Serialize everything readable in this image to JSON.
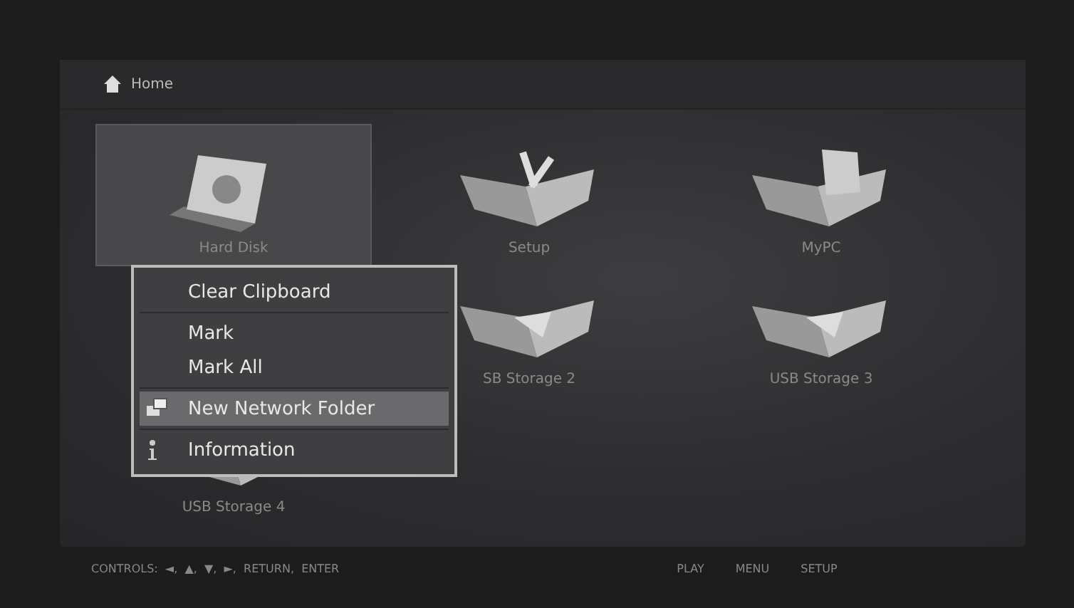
{
  "header": {
    "title": "Home"
  },
  "tiles": [
    {
      "label": "Hard Disk",
      "kind": "disk",
      "selected": true
    },
    {
      "label": "Setup",
      "kind": "setup",
      "selected": false
    },
    {
      "label": "MyPC",
      "kind": "pc",
      "selected": false
    },
    {
      "kind": "hidden"
    },
    {
      "label": "SB Storage 2",
      "kind": "usb",
      "selected": false
    },
    {
      "label": "USB Storage 3",
      "kind": "usb",
      "selected": false
    },
    {
      "label": "USB Storage 4",
      "kind": "usb",
      "selected": false
    }
  ],
  "menu": {
    "sections": [
      [
        {
          "label": "Clear Clipboard",
          "kind": "plain",
          "selected": false
        }
      ],
      [
        {
          "label": "Mark",
          "kind": "plain",
          "selected": false
        },
        {
          "label": "Mark All",
          "kind": "plain",
          "selected": false
        }
      ],
      [
        {
          "label": "New Network Folder",
          "kind": "network",
          "selected": true
        }
      ],
      [
        {
          "label": "Information",
          "kind": "info",
          "selected": false
        }
      ]
    ]
  },
  "footer": {
    "controls": "CONTROLS:  ◄,  ▲,  ▼,  ►,  RETURN,  ENTER",
    "keys": [
      "PLAY",
      "MENU",
      "SETUP"
    ]
  }
}
